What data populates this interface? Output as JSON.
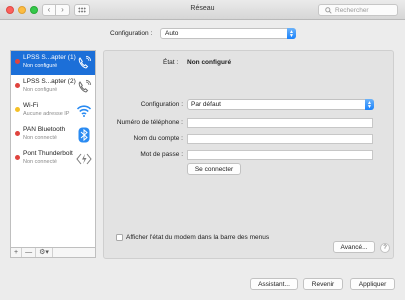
{
  "window": {
    "title": "Réseau"
  },
  "search": {
    "placeholder": "Rechercher"
  },
  "location": {
    "label": "Configuration :",
    "value": "Auto"
  },
  "services": [
    {
      "name": "LPSS S...apter (1)",
      "status": "Non configuré",
      "dot_color": "#e0443e",
      "icon": "phone-icon",
      "selected": true
    },
    {
      "name": "LPSS S...apter (2)",
      "status": "Non configuré",
      "dot_color": "#e0443e",
      "icon": "phone-icon",
      "selected": false
    },
    {
      "name": "Wi-Fi",
      "status": "Aucune adresse IP",
      "dot_color": "#f5c026",
      "icon": "wifi-icon",
      "selected": false
    },
    {
      "name": "PAN Bluetooth",
      "status": "Non connecté",
      "dot_color": "#e0443e",
      "icon": "bluetooth-icon",
      "selected": false
    },
    {
      "name": "Pont Thunderbolt",
      "status": "Non connecté",
      "dot_color": "#e0443e",
      "icon": "thunderbolt-icon",
      "selected": false
    }
  ],
  "sidebar_controls": {
    "add": "+",
    "remove": "—",
    "gear": "⚙▾"
  },
  "detail": {
    "status_label": "État :",
    "status_value": "Non configuré",
    "config_label": "Configuration :",
    "config_value": "Par défaut",
    "phone_label": "Numéro de téléphone :",
    "phone_value": "",
    "account_label": "Nom du compte :",
    "account_value": "",
    "password_label": "Mot de passe :",
    "password_value": "",
    "connect_button": "Se connecter",
    "checkbox_label": "Afficher l'état du modem dans la barre des menus",
    "advanced_button": "Avancé...",
    "help": "?"
  },
  "footer": {
    "assistant": "Assistant...",
    "revert": "Revenir",
    "apply": "Appliquer"
  },
  "colors": {
    "accent": "#1c6fd8",
    "red_dot": "#e0443e",
    "yellow_dot": "#f5c026"
  }
}
